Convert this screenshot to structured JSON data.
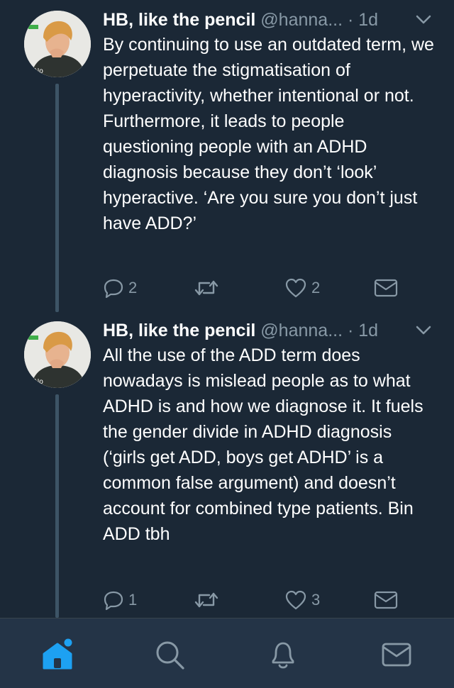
{
  "tweets": [
    {
      "name": "HB, like the pencil",
      "handle": "@hanna...",
      "separator": "·",
      "time": "1d",
      "text": "By continuing to use an outdated term, we perpetuate the stigmatisation of hyperactivity, whether intentional or not. Furthermore, it leads to people questioning people with an ADHD diagnosis because they don’t ‘look’ hyperactive. ‘Are you sure you don’t just have ADD?’",
      "reply_count": "2",
      "retweet_count": "",
      "like_count": "2"
    },
    {
      "name": "HB, like the pencil",
      "handle": "@hanna...",
      "separator": "·",
      "time": "1d",
      "text": "All the use of the ADD term does nowadays is mislead people as to what ADHD is and how we diagnose it. It fuels the gender divide in ADHD diagnosis (‘girls get ADD, boys get ADHD’ is a common false argument) and doesn’t account for combined type patients. Bin ADD tbh",
      "reply_count": "1",
      "retweet_count": "",
      "like_count": "3"
    }
  ],
  "tabbar": {
    "items": [
      "home-icon",
      "search-icon",
      "notifications-icon",
      "messages-icon"
    ],
    "active": "home-icon",
    "accent": "#1da1f2"
  },
  "colors": {
    "background": "#1b2836",
    "muted": "#8899a6",
    "tabbar": "#243447"
  }
}
